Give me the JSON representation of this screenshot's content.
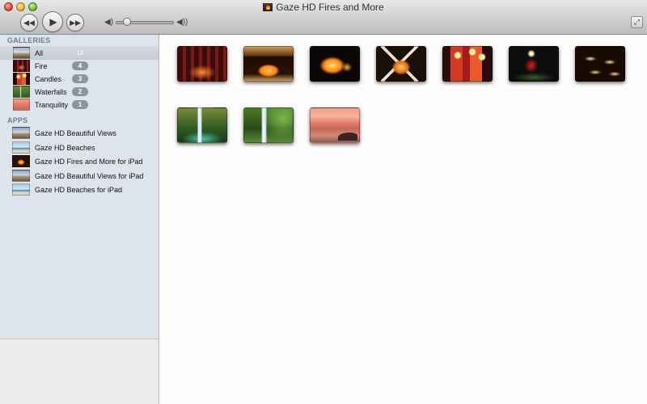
{
  "window": {
    "title": "Gaze HD Fires and More",
    "icon": "fireplace-icon"
  },
  "toolbar": {
    "rewind_icon": "rewind-icon",
    "play_icon": "play-icon",
    "fastforward_icon": "fast-forward-icon",
    "volume_level": 0.15,
    "fullscreen_icon": "fullscreen-icon"
  },
  "sidebar": {
    "galleries_header": "GALLERIES",
    "galleries": [
      {
        "label": "All",
        "count": "10",
        "selected": true
      },
      {
        "label": "Fire",
        "count": "4"
      },
      {
        "label": "Candles",
        "count": "3"
      },
      {
        "label": "Waterfalls",
        "count": "2"
      },
      {
        "label": "Tranquility",
        "count": "1"
      }
    ],
    "apps_header": "APPS",
    "apps": [
      {
        "label": "Gaze HD Beautiful Views"
      },
      {
        "label": "Gaze HD Beaches"
      },
      {
        "label": "Gaze HD Fires and More for iPad"
      },
      {
        "label": "Gaze HD Beautiful Views for iPad"
      },
      {
        "label": "Gaze HD Beaches for iPad"
      }
    ]
  },
  "colors": {
    "sidebar_bg": "#dee4ec",
    "badge_bg": "#8a94a0",
    "section_header": "#6f7f93"
  }
}
